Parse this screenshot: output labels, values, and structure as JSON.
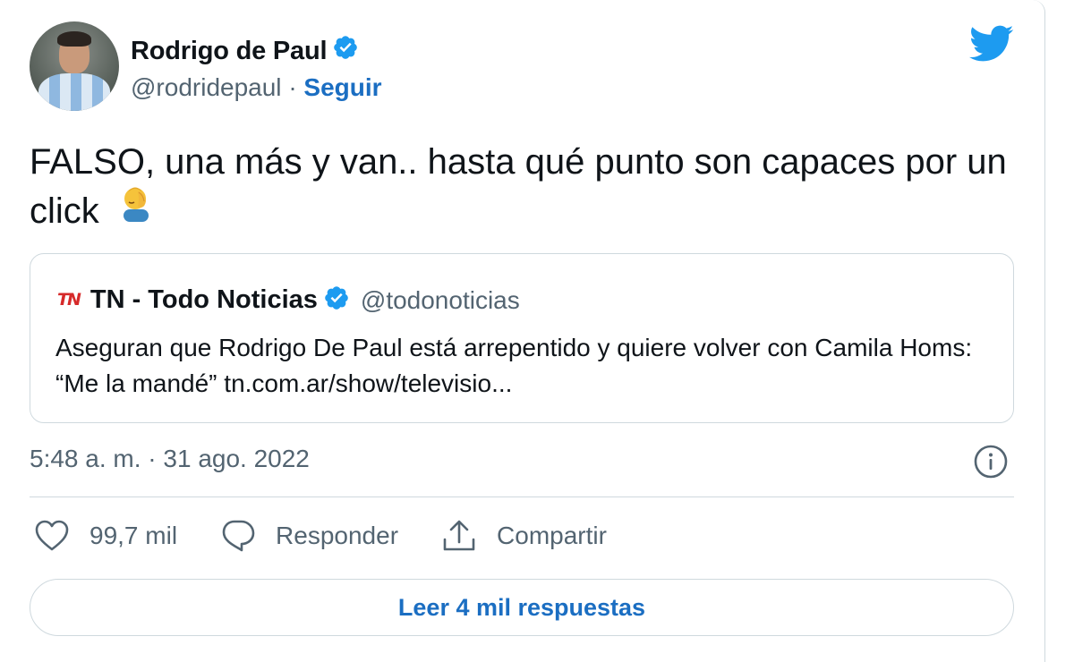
{
  "author": {
    "name": "Rodrigo de Paul",
    "handle": "@rodridepaul",
    "separator": "·",
    "follow_label": "Seguir"
  },
  "tweet": {
    "text": "FALSO, una más y van.. hasta qué punto son capaces por un click",
    "emoji": "face-palm-emoji"
  },
  "quoted": {
    "logo_text": "TN",
    "name": "TN - Todo Noticias",
    "handle": "@todonoticias",
    "text": "Aseguran que Rodrigo De Paul está arrepentido y quiere volver con Camila Homs: “Me la mandé” tn.com.ar/show/televisio..."
  },
  "meta": {
    "timestamp": "5:48 a. m. · 31 ago. 2022"
  },
  "actions": {
    "likes": "99,7 mil",
    "reply_label": "Responder",
    "share_label": "Compartir"
  },
  "read_replies_label": "Leer 4 mil respuestas",
  "colors": {
    "accent": "#1d9bf0",
    "link": "#1b6ec2",
    "secondary_text": "#536471",
    "border": "#cfd9de",
    "tn_red": "#d62a2a"
  },
  "icons": [
    "verified-badge-icon",
    "twitter-bird-icon",
    "info-icon",
    "heart-icon",
    "reply-icon",
    "share-icon"
  ]
}
